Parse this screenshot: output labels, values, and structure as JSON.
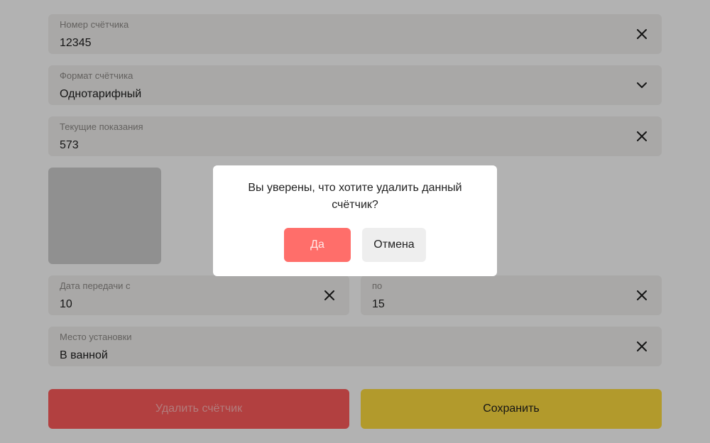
{
  "form": {
    "meter_number": {
      "label": "Номер счётчика",
      "value": "12345",
      "icon": "close-icon"
    },
    "meter_format": {
      "label": "Формат счётчика",
      "value": "Однотарифный",
      "icon": "chevron-down-icon"
    },
    "current_reading": {
      "label": "Текущие показания",
      "value": "573",
      "icon": "close-icon"
    },
    "submit_from": {
      "label": "Дата передачи с",
      "value": "10",
      "icon": "close-icon"
    },
    "submit_to": {
      "label": "по",
      "value": "15",
      "icon": "close-icon"
    },
    "install_place": {
      "label": "Место установки",
      "value": "В ванной",
      "icon": "close-icon"
    }
  },
  "actions": {
    "delete_label": "Удалить счётчик",
    "save_label": "Сохранить"
  },
  "dialog": {
    "message": "Вы уверены, что хотите удалить данный счётчик?",
    "confirm_label": "Да",
    "cancel_label": "Отмена"
  },
  "colors": {
    "field_bg": "#f2f1f0",
    "delete": "#ff5c5c",
    "save": "#ffdd3f",
    "confirm": "#ff6e6a",
    "overlay": "rgba(0,0,0,0.30)"
  }
}
